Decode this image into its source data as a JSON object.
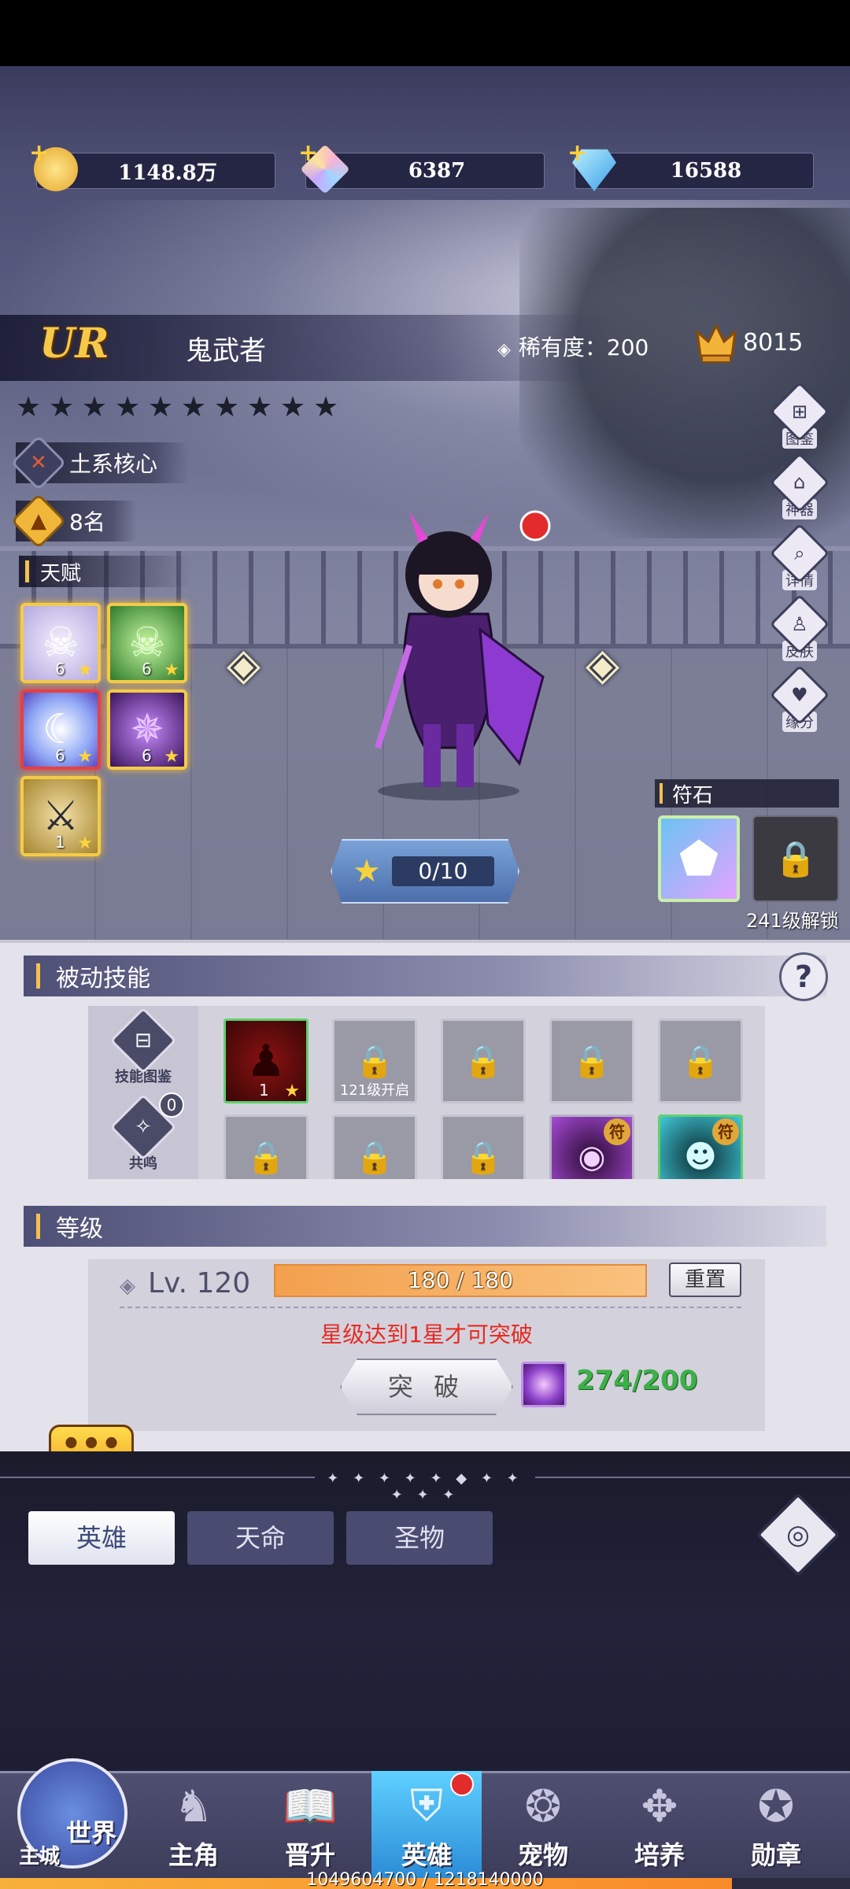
{
  "currency": [
    {
      "value": "1148.8万",
      "icon": "gold-coin-icon",
      "color": "#f4c542"
    },
    {
      "value": "6387",
      "icon": "rainbow-crystal-icon",
      "color": "#b28bf5"
    },
    {
      "value": "16588",
      "icon": "blue-diamond-icon",
      "color": "#59c2f5"
    }
  ],
  "hero": {
    "grade": "UR",
    "name": "鬼武者",
    "rarity_label": "稀有度：200",
    "power": "8015",
    "stars_count": 10,
    "star_glyph": "★",
    "faction": "土系核心",
    "rank": "8名"
  },
  "talent": {
    "title": "天赋",
    "skills": [
      {
        "level": "6",
        "icon": "skull-icon"
      },
      {
        "level": "6",
        "icon": "green-skull-icon"
      },
      {
        "level": "6",
        "icon": "white-slash-icon"
      },
      {
        "level": "6",
        "icon": "demon-sigil-icon"
      },
      {
        "level": "1",
        "icon": "dual-axe-icon"
      }
    ]
  },
  "star_up": {
    "progress": "0/10"
  },
  "rune": {
    "title": "符石",
    "unlock": "241级解锁"
  },
  "side_menu": [
    "图鉴",
    "神器",
    "详情",
    "皮肤",
    "缘分"
  ],
  "passive": {
    "title": "被动技能",
    "help": "?",
    "codex": "技能图鉴",
    "resonance": "共鸣",
    "resonance_count": "0",
    "active_skill": {
      "level": "1"
    },
    "locked_label": "121级开启",
    "rune_label": "符"
  },
  "level": {
    "title": "等级",
    "lv": "Lv. 120",
    "exp": "180 / 180",
    "exp_fraction": 1.0,
    "reset": "重置",
    "warning": "星级达到1星才可突破",
    "breakthrough": "突 破",
    "material": "274/200"
  },
  "bubble": "•••",
  "deco": "✦ ✦ ✦ ✦ ✦ ◆ ✦ ✦ ✦ ✦ ✦",
  "tabs": [
    "英雄",
    "天命",
    "圣物"
  ],
  "nav": {
    "world": "世界",
    "city": "主城",
    "items": [
      "主角",
      "晋升",
      "英雄",
      "宠物",
      "培养",
      "勋章"
    ]
  },
  "xp": {
    "text": "1049604700 / 1218140000",
    "fraction": 0.861
  }
}
